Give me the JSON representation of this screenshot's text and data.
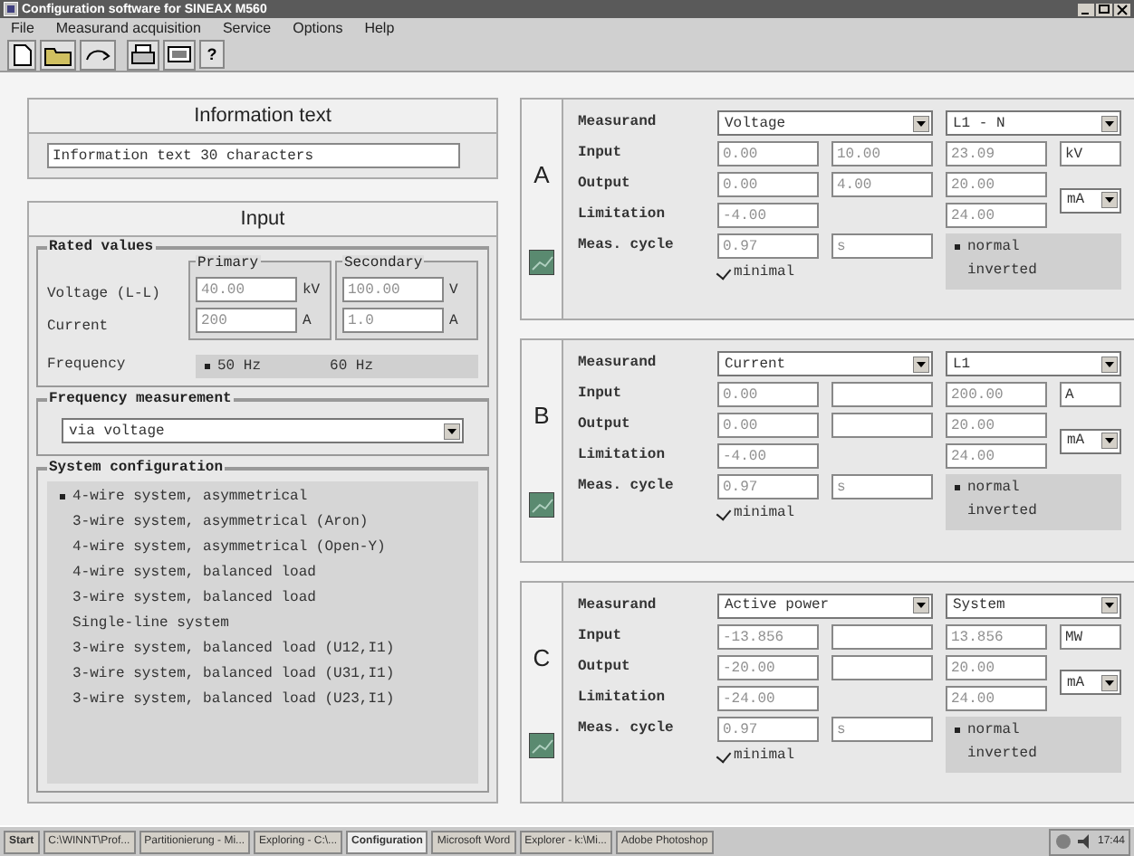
{
  "window": {
    "title": "Configuration software for SINEAX M560"
  },
  "menu": [
    "File",
    "Measurand acquisition",
    "Service",
    "Options",
    "Help"
  ],
  "toolbar": {
    "help": "?"
  },
  "info": {
    "title": "Information text",
    "value": "Information text 30 characters"
  },
  "input": {
    "title": "Input",
    "rated": {
      "title": "Rated values",
      "primary": "Primary",
      "secondary": "Secondary",
      "rows": [
        {
          "label": "Voltage (L-L)",
          "primary": "40.00",
          "primary_unit": "kV",
          "secondary": "100.00",
          "secondary_unit": "V"
        },
        {
          "label": "Current",
          "primary": "200",
          "primary_unit": "A",
          "secondary": "1.0",
          "secondary_unit": "A"
        }
      ],
      "frequency": {
        "label": "Frequency",
        "options": [
          {
            "label": "50 Hz",
            "selected": true
          },
          {
            "label": "60 Hz",
            "selected": false
          }
        ]
      }
    },
    "freq_measurement": {
      "title": "Frequency measurement",
      "value": "via voltage"
    },
    "system": {
      "title": "System configuration",
      "options": [
        {
          "label": "4-wire system, asymmetrical",
          "selected": true
        },
        {
          "label": "3-wire system, asymmetrical (Aron)",
          "selected": false
        },
        {
          "label": "4-wire system, asymmetrical (Open-Y)",
          "selected": false
        },
        {
          "label": "4-wire system, balanced load",
          "selected": false
        },
        {
          "label": "3-wire system, balanced load",
          "selected": false
        },
        {
          "label": "Single-line system",
          "selected": false
        },
        {
          "label": "3-wire system, balanced load (U12,I1)",
          "selected": false
        },
        {
          "label": "3-wire system, balanced load (U31,I1)",
          "selected": false
        },
        {
          "label": "3-wire system, balanced load (U23,I1)",
          "selected": false
        }
      ]
    }
  },
  "channels": [
    {
      "letter": "A",
      "measurand": {
        "label": "Measurand",
        "value": "Voltage",
        "phase": "L1 - N"
      },
      "input": {
        "label": "Input",
        "low": "0.00",
        "mid": "10.00",
        "high": "23.09",
        "unit": "kV"
      },
      "output": {
        "label": "Output",
        "low": "0.00",
        "mid": "4.00",
        "high": "20.00",
        "unit": "mA"
      },
      "limitation": {
        "label": "Limitation",
        "low": "-4.00",
        "high": "24.00"
      },
      "cycle": {
        "label": "Meas. cycle",
        "value": "0.97",
        "unit": "s"
      },
      "minimal": {
        "label": "minimal",
        "checked": true
      },
      "polarity": [
        {
          "label": "normal",
          "selected": true
        },
        {
          "label": "inverted",
          "selected": false
        }
      ]
    },
    {
      "letter": "B",
      "measurand": {
        "label": "Measurand",
        "value": "Current",
        "phase": "L1"
      },
      "input": {
        "label": "Input",
        "low": "0.00",
        "high": "200.00",
        "unit": "A"
      },
      "output": {
        "label": "Output",
        "low": "0.00",
        "high": "20.00",
        "unit": "mA"
      },
      "limitation": {
        "label": "Limitation",
        "low": "-4.00",
        "high": "24.00"
      },
      "cycle": {
        "label": "Meas. cycle",
        "value": "0.97",
        "unit": "s"
      },
      "minimal": {
        "label": "minimal",
        "checked": true
      },
      "polarity": [
        {
          "label": "normal",
          "selected": true
        },
        {
          "label": "inverted",
          "selected": false
        }
      ]
    },
    {
      "letter": "C",
      "measurand": {
        "label": "Measurand",
        "value": "Active power",
        "phase": "System"
      },
      "input": {
        "label": "Input",
        "low": "-13.856",
        "high": "13.856",
        "unit": "MW"
      },
      "output": {
        "label": "Output",
        "low": "-20.00",
        "high": "20.00",
        "unit": "mA"
      },
      "limitation": {
        "label": "Limitation",
        "low": "-24.00",
        "high": "24.00"
      },
      "cycle": {
        "label": "Meas. cycle",
        "value": "0.97",
        "unit": "s"
      },
      "minimal": {
        "label": "minimal",
        "checked": true
      },
      "polarity": [
        {
          "label": "normal",
          "selected": true
        },
        {
          "label": "inverted",
          "selected": false
        }
      ]
    }
  ],
  "taskbar": {
    "start": "Start",
    "tasks": [
      {
        "label": "C:\\WINNT\\Prof...",
        "selected": false
      },
      {
        "label": "Partitionierung - Mi...",
        "selected": false
      },
      {
        "label": "Exploring - C:\\...",
        "selected": false
      },
      {
        "label": "Configuration",
        "selected": true
      },
      {
        "label": "Microsoft Word",
        "selected": false
      },
      {
        "label": "Explorer - k:\\Mi...",
        "selected": false
      },
      {
        "label": "Adobe Photoshop",
        "selected": false
      }
    ],
    "clock": "17:44"
  }
}
